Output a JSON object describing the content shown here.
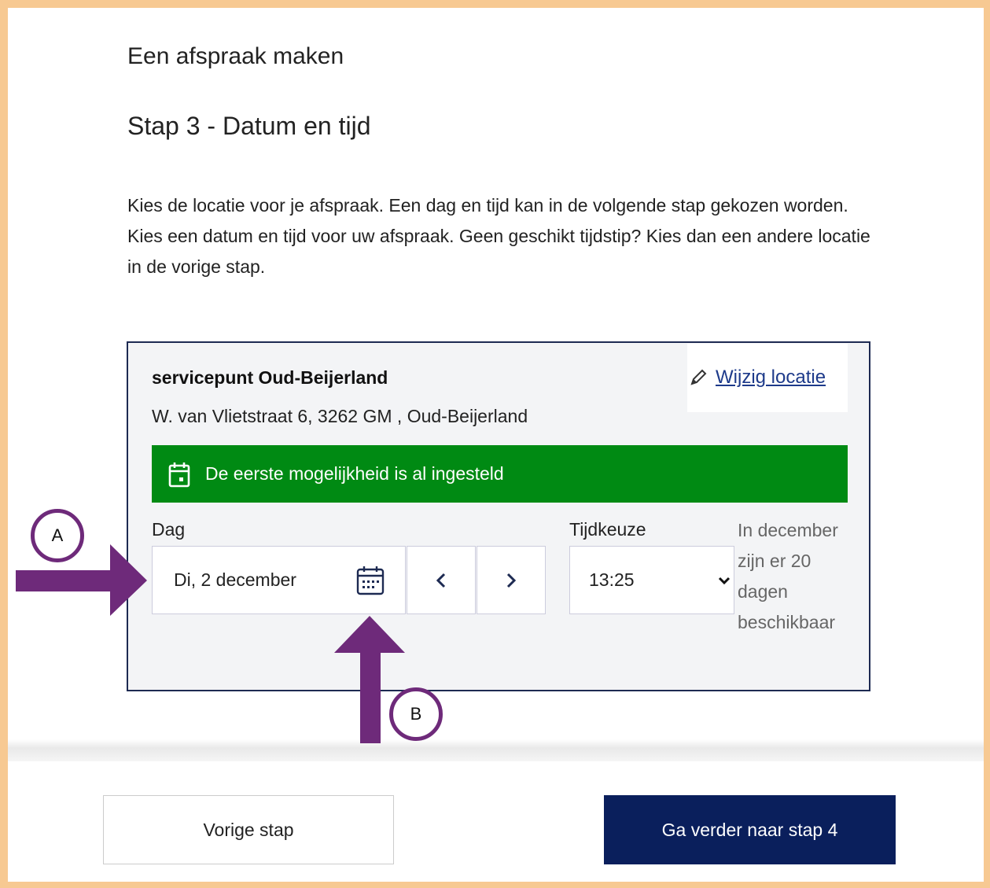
{
  "page": {
    "heading": "Een afspraak maken",
    "step_title": "Stap 3 - Datum en tijd",
    "intro": "Kies de locatie voor je afspraak. Een dag en tijd kan in de volgende stap gekozen worden. Kies een datum en tijd voor uw afspraak. Geen geschikt tijdstip? Kies dan een andere locatie in de vorige stap."
  },
  "location": {
    "name": "servicepunt Oud-Beijerland",
    "address": "W. van Vlietstraat 6, 3262 GM , Oud-Beijerland",
    "edit_label": "Wijzig locatie"
  },
  "notice": {
    "text": "De eerste mogelijkheid is al ingesteld",
    "color": "#008a13"
  },
  "date": {
    "label": "Dag",
    "value": "Di, 2 december",
    "prev_icon": "chevron-left",
    "next_icon": "chevron-right"
  },
  "time": {
    "label": "Tijdkeuze",
    "value": "13:25"
  },
  "availability": "In december zijn er 20 dagen beschikbaar",
  "footer": {
    "prev_label": "Vorige stap",
    "next_label": "Ga verder naar stap 4"
  },
  "annotations": {
    "a_label": "A",
    "b_label": "B",
    "arrow_color": "#6e2a7a",
    "frame_color": "#f7c992"
  }
}
